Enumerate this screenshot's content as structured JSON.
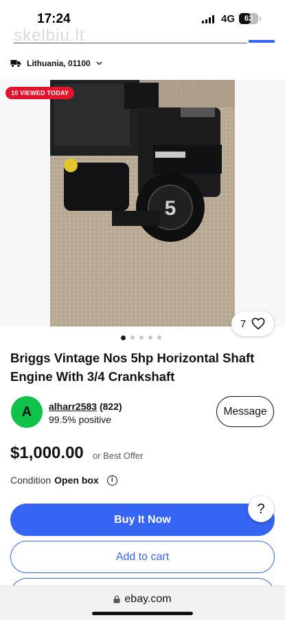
{
  "status_bar": {
    "time": "17:24",
    "network": "4G",
    "battery": "62",
    "battery_level": 0.62
  },
  "watermark": "skelbiu.lt",
  "location": {
    "label": "Lithuania, 01100",
    "icon": "truck-icon"
  },
  "listing": {
    "viewed_badge": "10 VIEWED TODAY",
    "favorites_count": "7",
    "image_index": 1,
    "image_count": 5,
    "title": "Briggs Vintage Nos 5hp Horizontal Shaft Engine With 3/4 Crankshaft"
  },
  "seller": {
    "avatar_letter": "A",
    "username": "alharr2583",
    "feedback_count": "(822)",
    "positive": "99.5% positive",
    "message_label": "Message"
  },
  "price": {
    "amount": "$1,000.00",
    "offer_text": "or Best Offer"
  },
  "condition": {
    "label": "Condition",
    "value": "Open box"
  },
  "actions": {
    "buy_now": "Buy It Now",
    "add_to_cart": "Add to cart",
    "help": "?"
  },
  "browser": {
    "url": "ebay.com"
  },
  "colors": {
    "accent": "#3665f3",
    "badge": "#e0142b",
    "avatar": "#0fc24a"
  }
}
